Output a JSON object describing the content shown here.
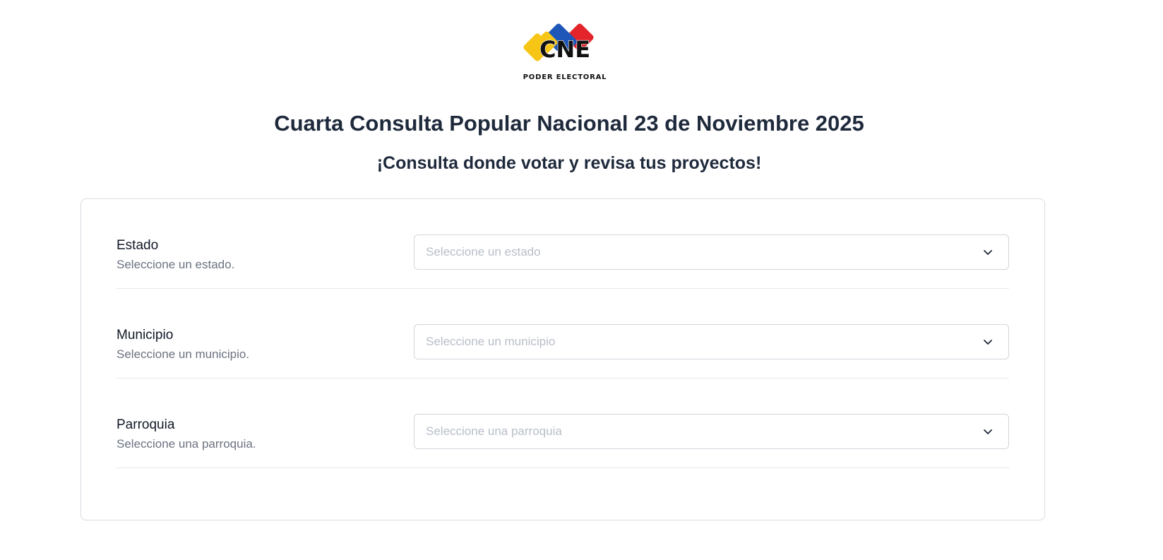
{
  "header": {
    "logo_text": "CNE",
    "logo_subtext": "PODER ELECTORAL",
    "title": "Cuarta Consulta Popular Nacional 23 de Noviembre 2025",
    "subtitle": "¡Consulta donde votar y revisa tus proyectos!"
  },
  "colors": {
    "logo_yellow": "#f6c516",
    "logo_blue": "#1f57b8",
    "logo_red": "#e3242b",
    "text_dark": "#1e293b",
    "text_muted": "#6b7280",
    "placeholder": "#b8bec8",
    "border": "#d1d5db"
  },
  "form": {
    "fields": [
      {
        "label": "Estado",
        "description": "Seleccione un estado.",
        "placeholder": "Seleccione un estado",
        "icon": "chevron-down-icon"
      },
      {
        "label": "Municipio",
        "description": "Seleccione un municipio.",
        "placeholder": "Seleccione un municipio",
        "icon": "chevron-down-icon"
      },
      {
        "label": "Parroquia",
        "description": "Seleccione una parroquia.",
        "placeholder": "Seleccione una parroquia",
        "icon": "chevron-down-icon"
      }
    ]
  }
}
